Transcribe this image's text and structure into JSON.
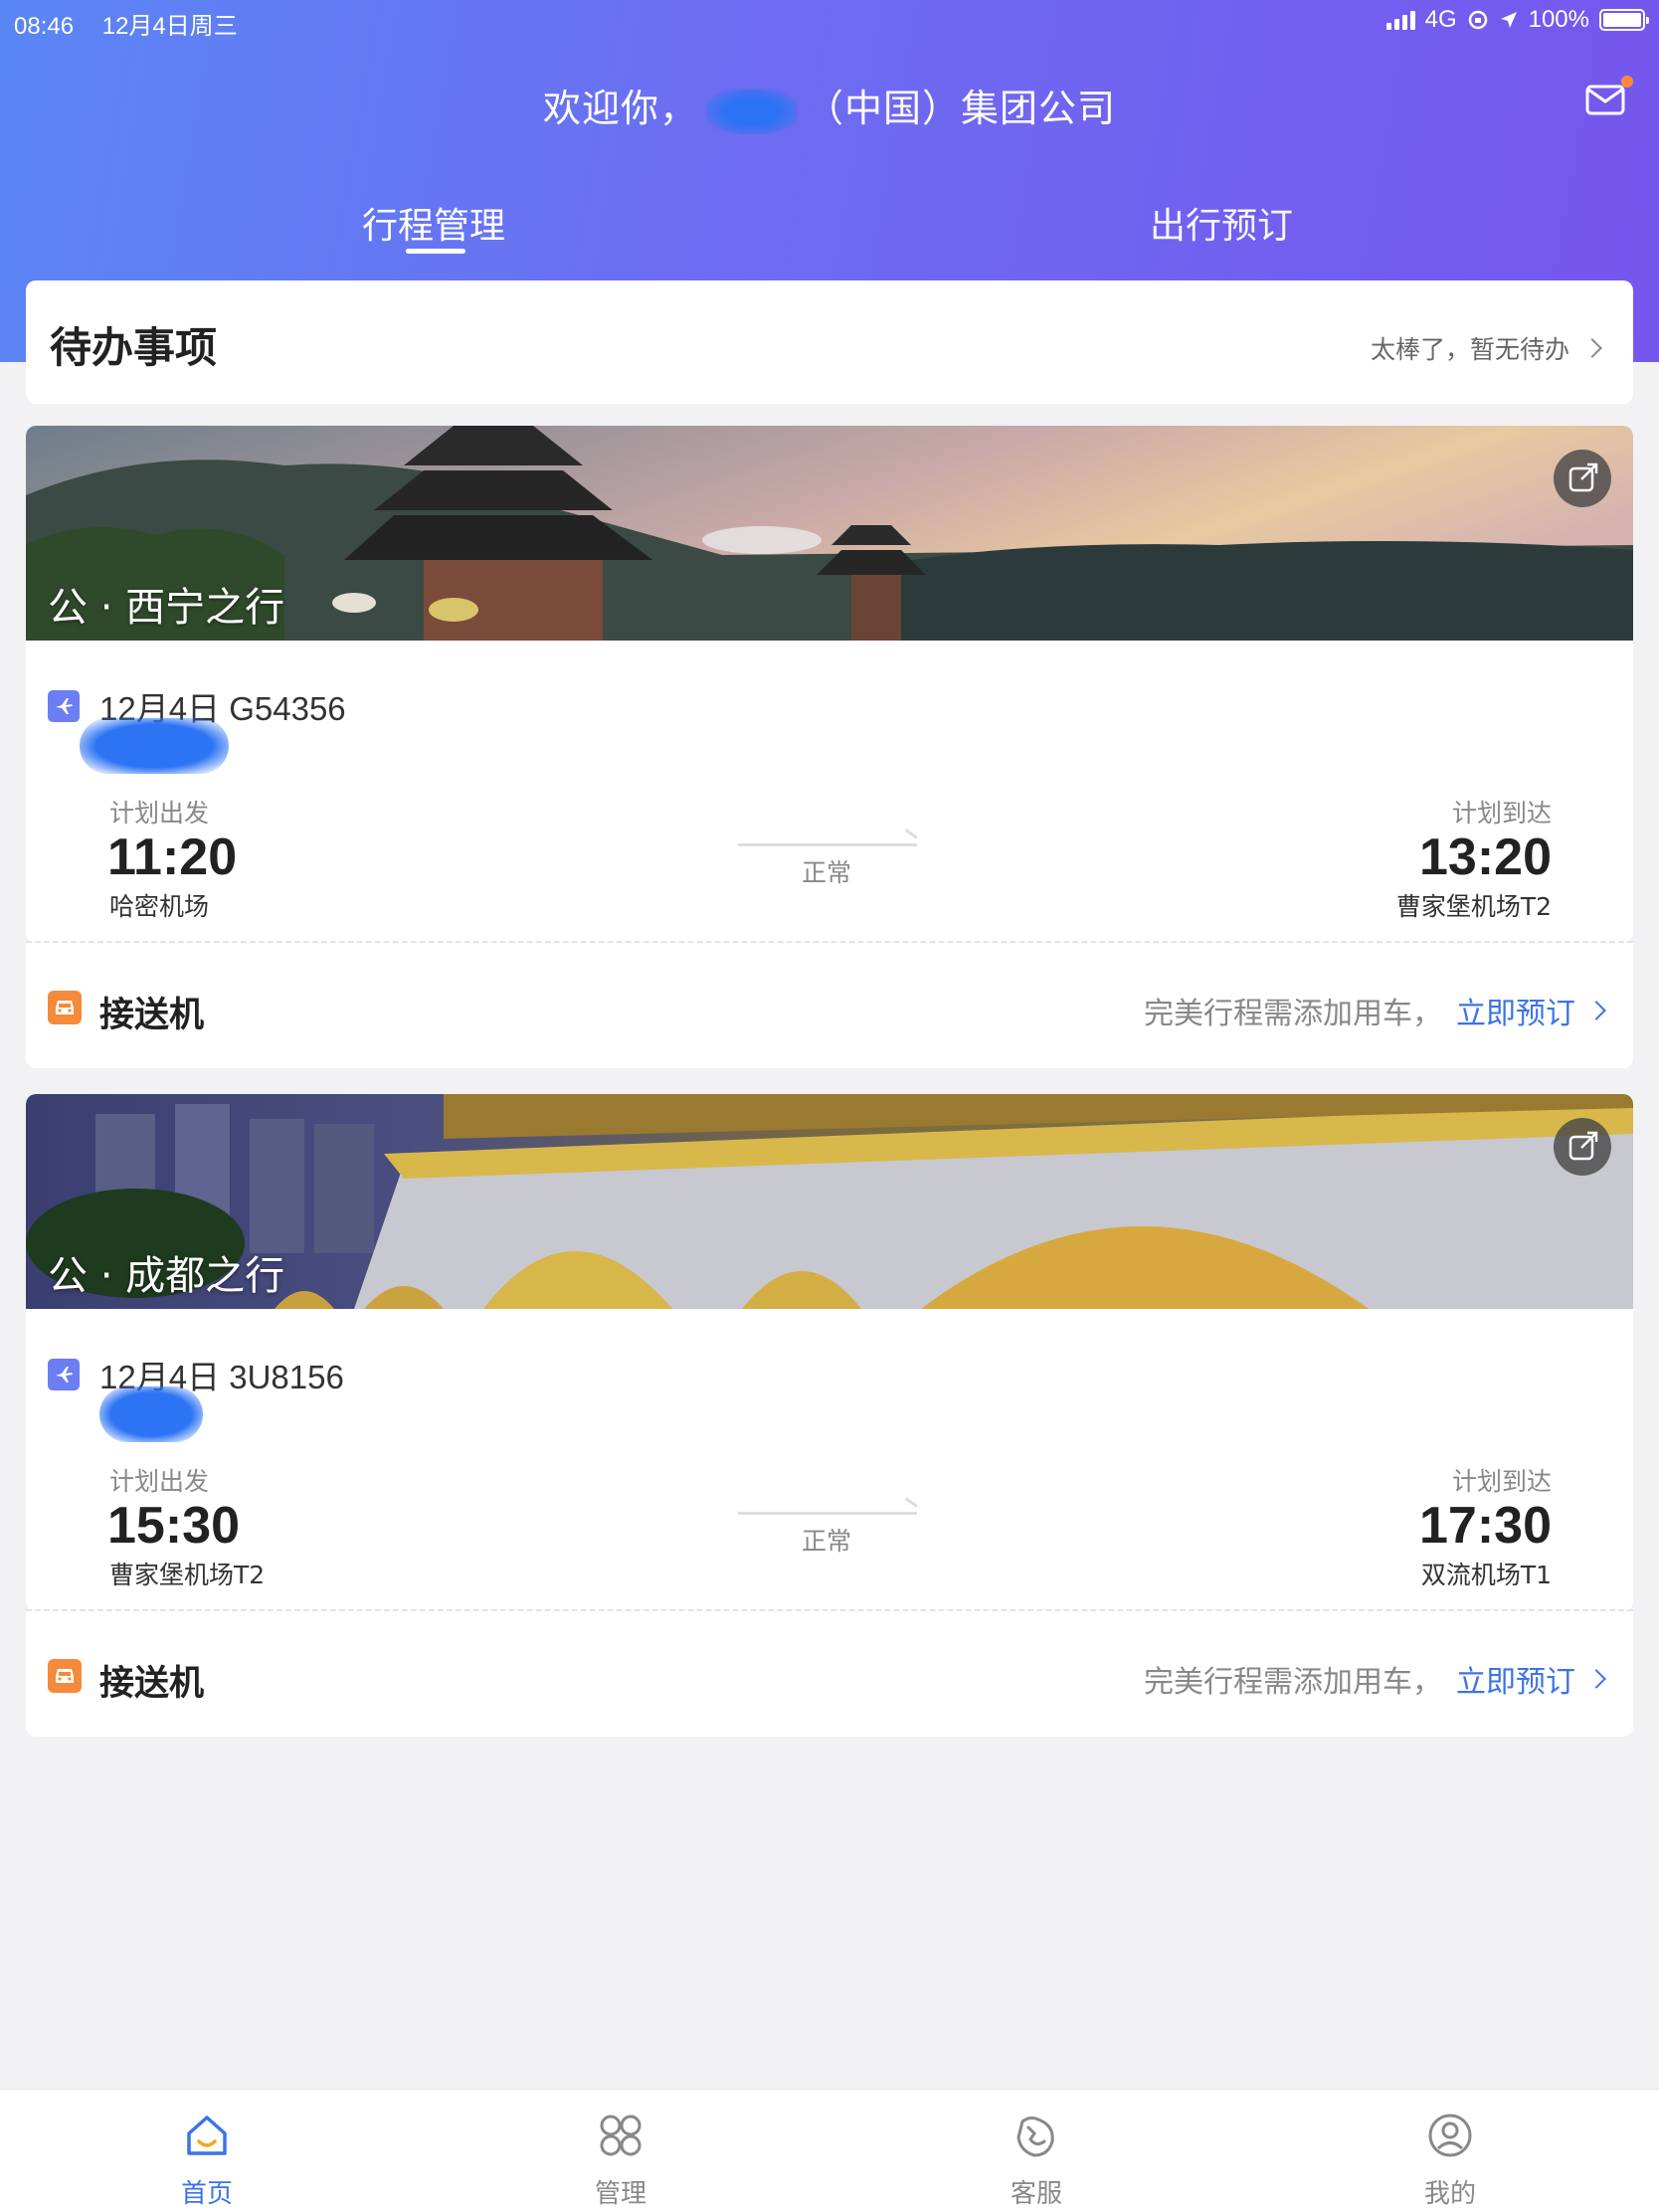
{
  "status_bar": {
    "time": "08:46",
    "date": "12月4日周三",
    "network": "4G",
    "battery": "100%"
  },
  "header": {
    "welcome_prefix": "欢迎你，",
    "company_suffix": "（中国）集团公司",
    "tabs": [
      {
        "label": "行程管理",
        "active": true
      },
      {
        "label": "出行预订",
        "active": false
      }
    ]
  },
  "todo": {
    "title": "待办事项",
    "status": "太棒了，暂无待办"
  },
  "trips": [
    {
      "title": "公 · 西宁之行",
      "flight": "12月4日 G54356",
      "dep_label": "计划出发",
      "dep_time": "11:20",
      "dep_airport": "哈密机场",
      "arr_label": "计划到达",
      "arr_time": "13:20",
      "arr_airport": "曹家堡机场T2",
      "status": "正常",
      "pickup": {
        "label": "接送机",
        "hint": "完美行程需添加用车，",
        "action": "立即预订"
      }
    },
    {
      "title": "公 · 成都之行",
      "flight": "12月4日 3U8156",
      "dep_label": "计划出发",
      "dep_time": "15:30",
      "dep_airport": "曹家堡机场T2",
      "arr_label": "计划到达",
      "arr_time": "17:30",
      "arr_airport": "双流机场T1",
      "status": "正常",
      "pickup": {
        "label": "接送机",
        "hint": "完美行程需添加用车，",
        "action": "立即预订"
      }
    }
  ],
  "bottom_nav": [
    {
      "label": "首页",
      "icon": "home-icon",
      "active": true
    },
    {
      "label": "管理",
      "icon": "grid-icon",
      "active": false
    },
    {
      "label": "客服",
      "icon": "customer-service-icon",
      "active": false
    },
    {
      "label": "我的",
      "icon": "profile-icon",
      "active": false
    }
  ],
  "colors": {
    "accent": "#3d73e8",
    "header_start": "#5a86f4",
    "header_end": "#7556ee",
    "car_orange": "#f58a3a",
    "plane_purple": "#6b7ef3"
  }
}
